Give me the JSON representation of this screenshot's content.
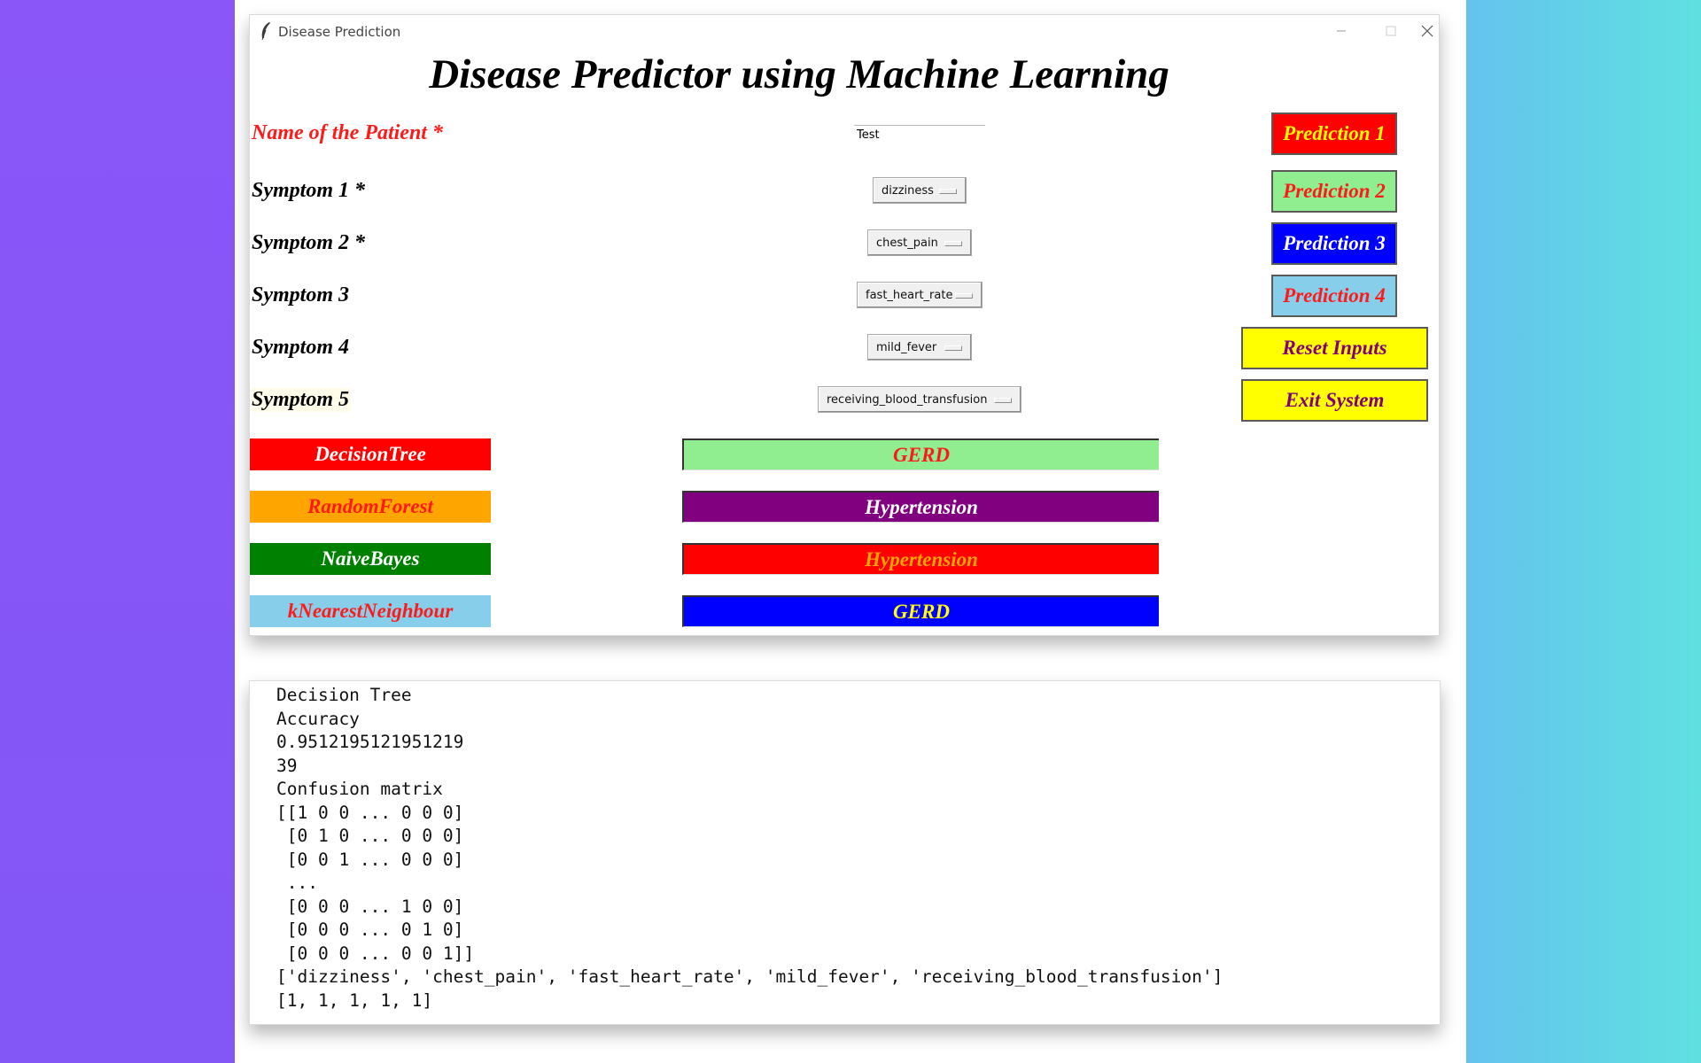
{
  "window": {
    "title": "Disease Prediction",
    "heading": "Disease Predictor using Machine Learning"
  },
  "form": {
    "patient_label": "Name of the Patient *",
    "patient_value": "Test",
    "symptoms": [
      {
        "label": "Symptom 1 *",
        "value": "dizziness"
      },
      {
        "label": "Symptom 2 *",
        "value": "chest_pain"
      },
      {
        "label": "Symptom 3",
        "value": "fast_heart_rate"
      },
      {
        "label": "Symptom 4",
        "value": "mild_fever"
      },
      {
        "label": "Symptom 5",
        "value": "receiving_blood_transfusion"
      }
    ]
  },
  "buttons": {
    "prediction1": "Prediction 1",
    "prediction2": "Prediction 2",
    "prediction3": "Prediction 3",
    "prediction4": "Prediction 4",
    "reset": "Reset Inputs",
    "exit": "Exit System"
  },
  "algorithms": [
    {
      "name": "DecisionTree",
      "result": "GERD"
    },
    {
      "name": "RandomForest",
      "result": "Hypertension"
    },
    {
      "name": "NaiveBayes",
      "result": "Hypertension"
    },
    {
      "name": "kNearestNeighbour",
      "result": "GERD"
    }
  ],
  "colors": {
    "algo_backgrounds": [
      "#ff0000",
      "#ffa500",
      "#008000",
      "#87ceeb"
    ],
    "algo_text": [
      "#ffffff",
      "#ff1a1a",
      "#ffffff",
      "#ff1a1a"
    ],
    "result_backgrounds": [
      "#90ee90",
      "#800080",
      "#ff0000",
      "#0000ff"
    ],
    "result_text": [
      "#ff1a1a",
      "#ffffff",
      "#ffa500",
      "#ffff00"
    ]
  },
  "console": {
    "lines": [
      "Decision Tree",
      "Accuracy",
      "0.9512195121951219",
      "39",
      "Confusion matrix",
      "[[1 0 0 ... 0 0 0]",
      " [0 1 0 ... 0 0 0]",
      " [0 0 1 ... 0 0 0]",
      " ...",
      " [0 0 0 ... 1 0 0]",
      " [0 0 0 ... 0 1 0]",
      " [0 0 0 ... 0 0 1]]",
      "['dizziness', 'chest_pain', 'fast_heart_rate', 'mild_fever', 'receiving_blood_transfusion']",
      "[1, 1, 1, 1, 1]"
    ]
  }
}
